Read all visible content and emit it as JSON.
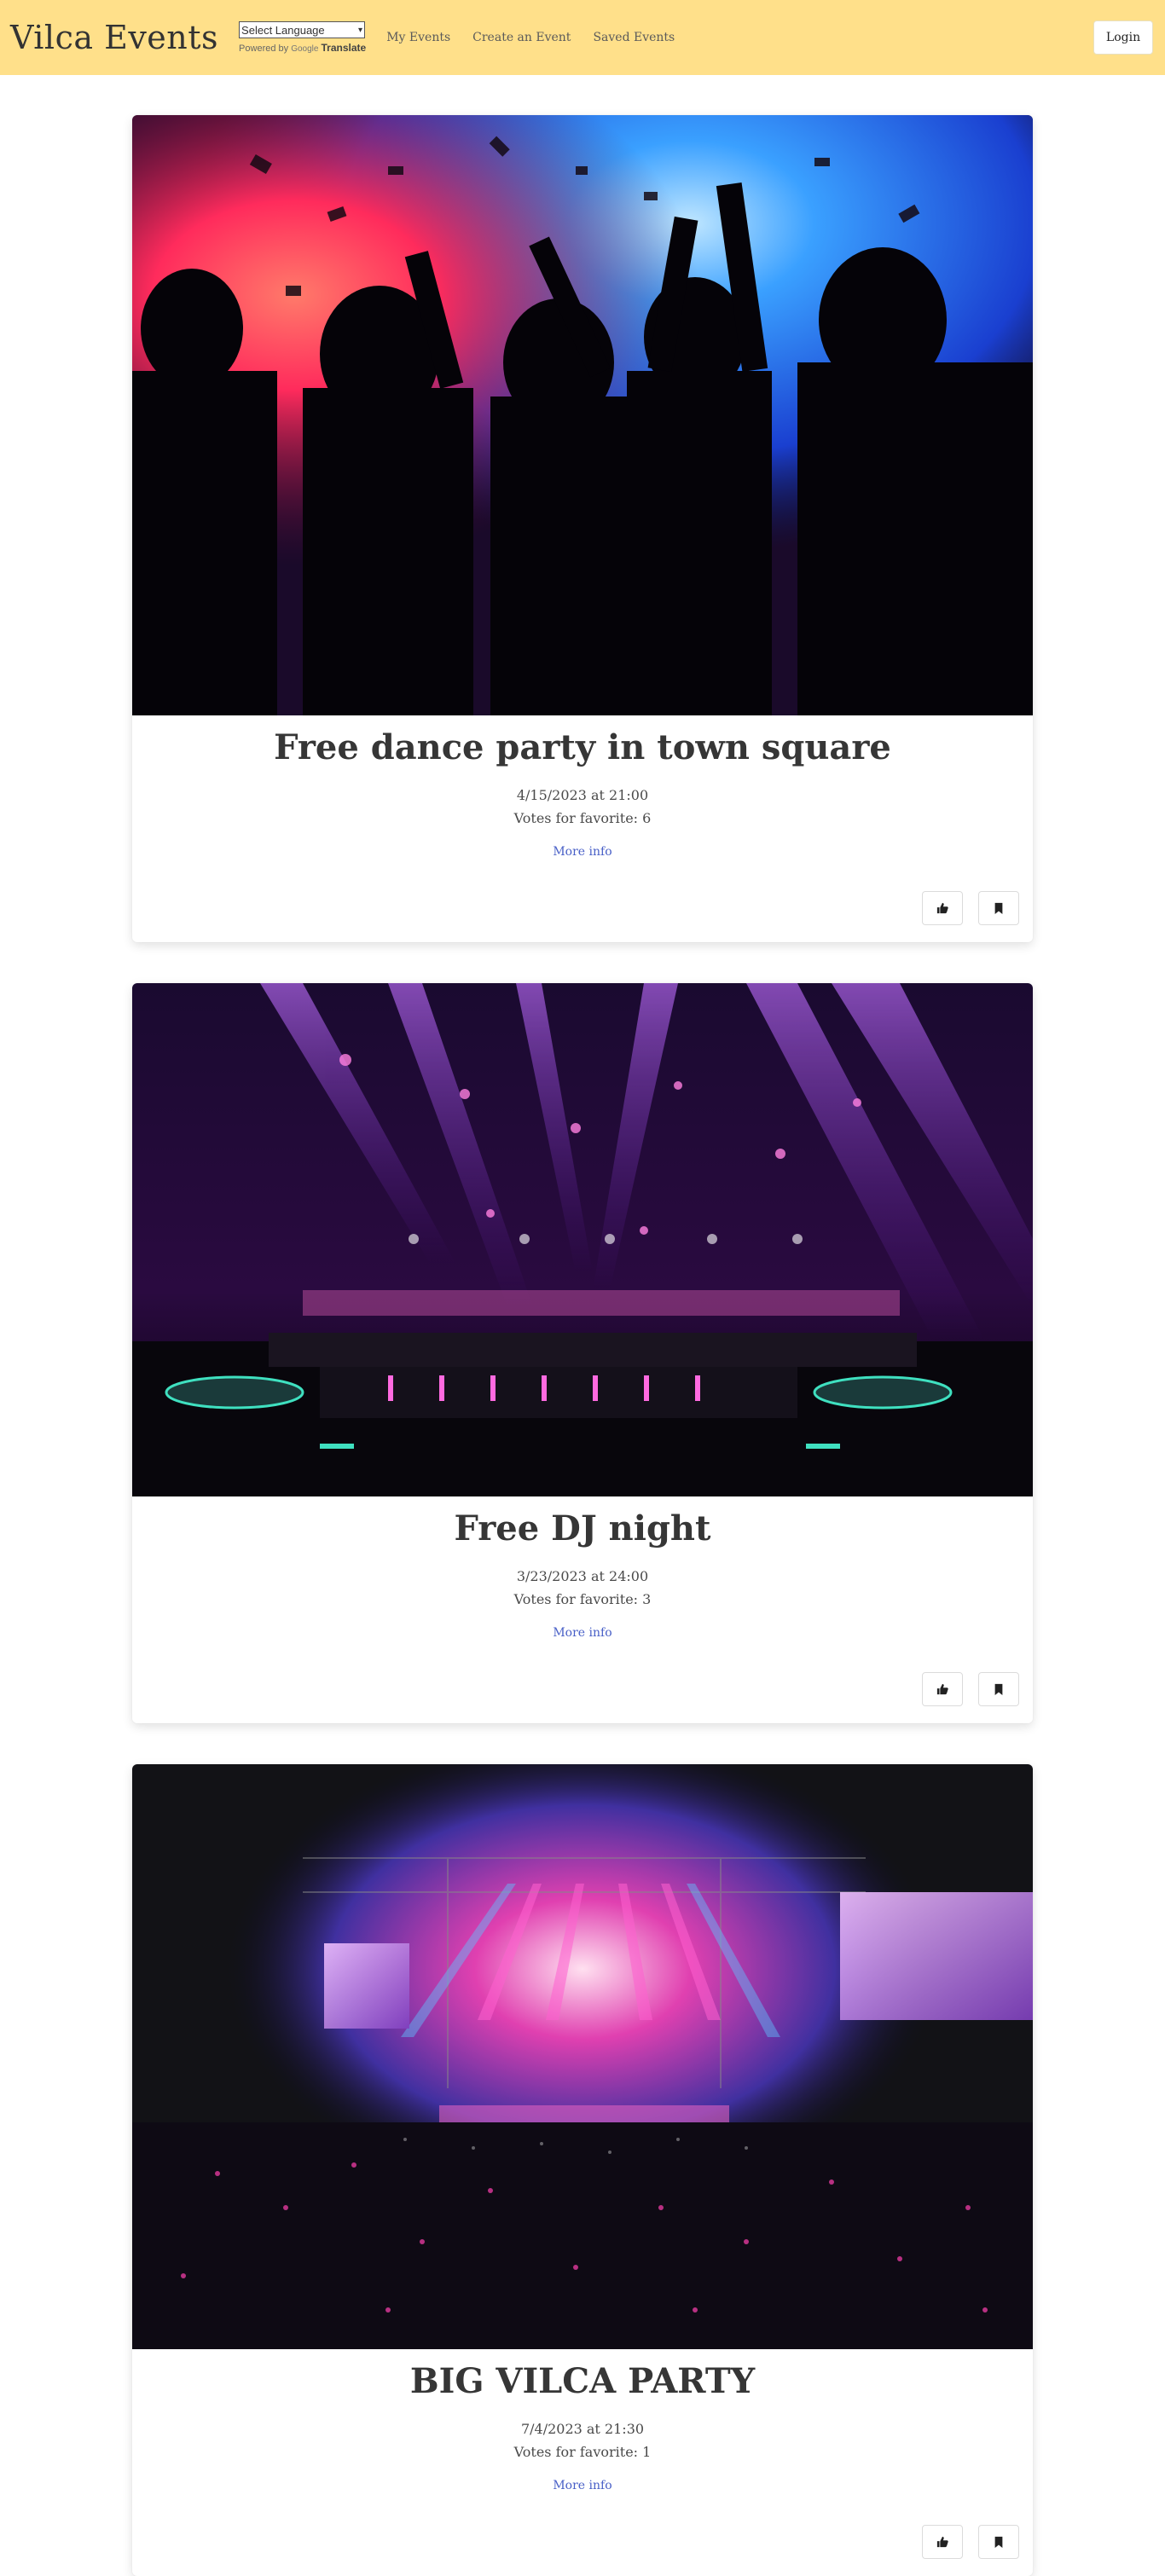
{
  "header": {
    "brand": "Vilca Events",
    "language_select": "Select Language",
    "powered_by": "Powered by",
    "google": "Google",
    "translate": "Translate",
    "nav": [
      "My Events",
      "Create an Event",
      "Saved Events"
    ],
    "login": "Login",
    "background_color": "#ffe08a"
  },
  "events": [
    {
      "title": "Free dance party in town square",
      "date": "4/15/2023 at 21:00",
      "votes": "Votes for favorite: 6",
      "more_info": "More info",
      "image_icon": "dance-party-photo"
    },
    {
      "title": "Free DJ night",
      "date": "3/23/2023 at 24:00",
      "votes": "Votes for favorite: 3",
      "more_info": "More info",
      "image_icon": "dj-booth-photo"
    },
    {
      "title": "BIG VILCA PARTY",
      "date": "7/4/2023 at 21:30",
      "votes": "Votes for favorite: 1",
      "more_info": "More info",
      "image_icon": "concert-arena-photo"
    }
  ],
  "icons": {
    "like": "thumbs-up-icon",
    "save": "bookmark-icon"
  }
}
